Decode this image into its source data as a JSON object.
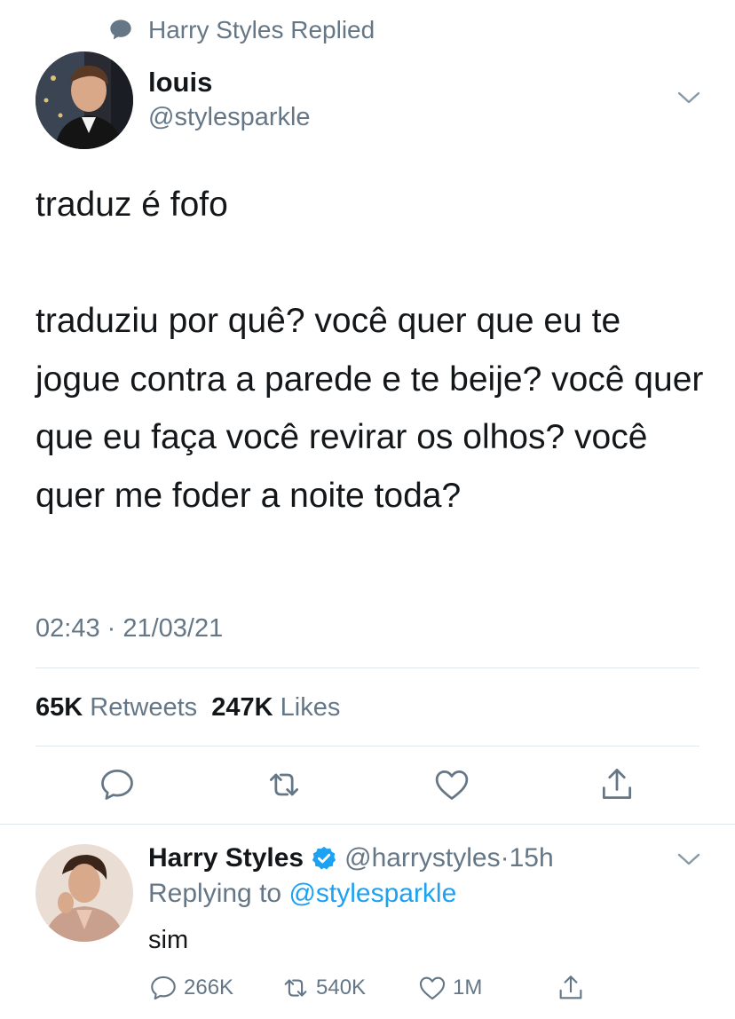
{
  "social_context": {
    "icon": "speech-bubble-icon",
    "text": "Harry Styles Replied"
  },
  "main_tweet": {
    "avatar": "avatar-louis",
    "name": "louis",
    "handle": "@stylesparkle",
    "text": "traduz é fofo\n\ntraduziu por quê? você quer que eu te jogue contra a parede e te beije? você quer que eu faça você revirar os olhos? você quer me foder a noite toda?",
    "timestamp": "02:43 · 21/03/21",
    "retweets_count": "65K",
    "retweets_label": "Retweets",
    "likes_count": "247K",
    "likes_label": "Likes",
    "actions": [
      "reply-icon",
      "retweet-icon",
      "like-icon",
      "share-icon"
    ]
  },
  "reply_tweet": {
    "avatar": "avatar-harry",
    "name": "Harry Styles",
    "verified": true,
    "handle": "@harrystyles",
    "separator": "·",
    "time": "15h",
    "replying_prefix": "Replying to",
    "replying_to": "@stylesparkle",
    "text": "sim",
    "reply_count": "266K",
    "retweet_count": "540K",
    "like_count": "1M"
  },
  "colors": {
    "text": "#14171a",
    "muted": "#657786",
    "accent": "#1da1f2",
    "divider": "#e1e8ed"
  }
}
